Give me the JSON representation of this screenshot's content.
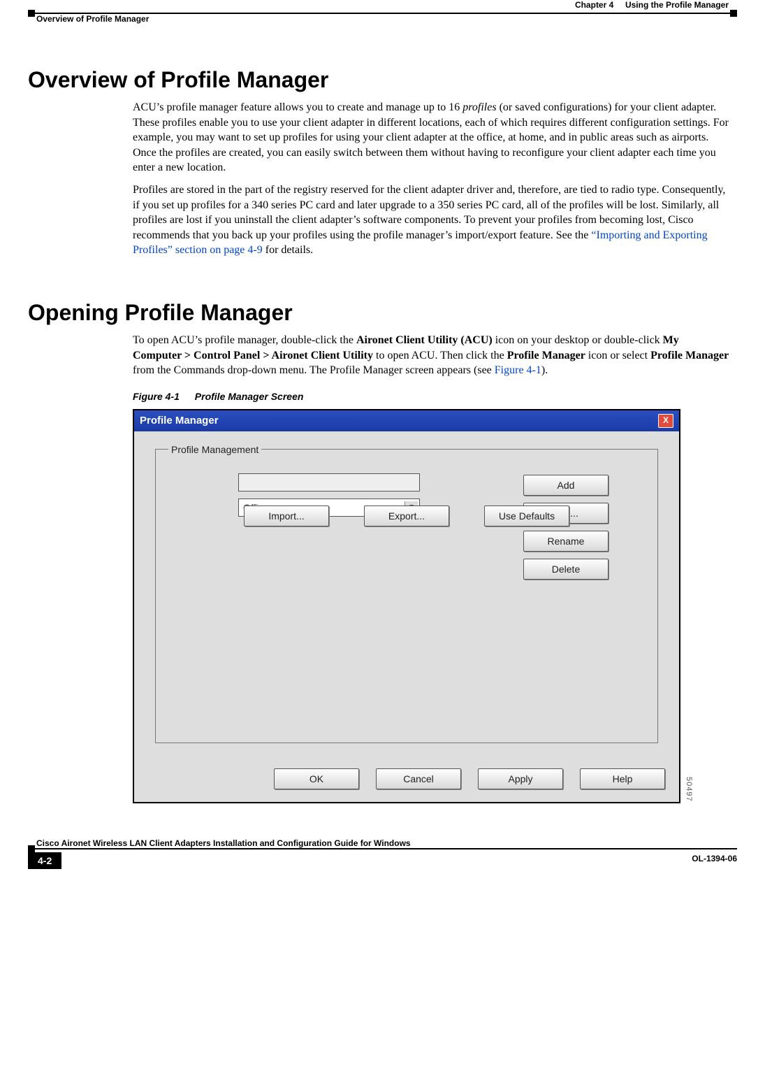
{
  "header": {
    "chapter_label": "Chapter 4",
    "chapter_title": "Using the Profile Manager",
    "section_title": "Overview of Profile Manager"
  },
  "section1": {
    "heading": "Overview of Profile Manager",
    "para1_a": "ACU’s profile manager feature allows you to create and manage up to 16 ",
    "para1_em": "profiles",
    "para1_b": " (or saved configurations) for your client adapter. These profiles enable you to use your client adapter in different locations, each of which requires different configuration settings. For example, you may want to set up profiles for using your client adapter at the office, at home, and in public areas such as airports. Once the profiles are created, you can easily switch between them without having to reconfigure your client adapter each time you enter a new location.",
    "para2_a": "Profiles are stored in the part of the registry reserved for the client adapter driver and, therefore, are tied to radio type. Consequently, if you set up profiles for a 340 series PC card and later upgrade to a 350 series PC card, all of the profiles will be lost. Similarly, all profiles are lost if you uninstall the client adapter’s software components. To prevent your profiles from becoming lost, Cisco recommends that you back up your profiles using the profile manager’s import/export feature. See the ",
    "para2_link": "“Importing and Exporting Profiles” section on page 4-9",
    "para2_b": " for details."
  },
  "section2": {
    "heading": "Opening Profile Manager",
    "para_a": "To open ACU’s profile manager, double-click the ",
    "para_b1": "Aironet Client Utility (ACU)",
    "para_c": " icon on your desktop or double-click ",
    "para_b2": "My Computer",
    "gt1": " > ",
    "para_b3": "Control Panel",
    "gt2": " > ",
    "para_b4": "Aironet Client Utility",
    "para_d": " to open ACU. Then click the ",
    "para_b5": "Profile Manager",
    "para_e": " icon or select ",
    "para_b6": "Profile Manager",
    "para_f": " from the Commands drop-down menu. The Profile Manager screen appears (see ",
    "para_link": "Figure 4-1",
    "para_g": ")."
  },
  "figure": {
    "num": "Figure 4-1",
    "title": "Profile Manager Screen",
    "side_id": "50497"
  },
  "dialog": {
    "title": "Profile Manager",
    "close": "X",
    "group_label": "Profile Management",
    "text_value": "",
    "combo_value": "Office",
    "buttons": {
      "add": "Add",
      "edit": "Edit...",
      "rename": "Rename",
      "delete": "Delete",
      "import": "Import...",
      "export": "Export...",
      "use_defaults": "Use Defaults",
      "ok": "OK",
      "cancel": "Cancel",
      "apply": "Apply",
      "help": "Help"
    }
  },
  "footer": {
    "guide": "Cisco Aironet Wireless LAN Client Adapters Installation and Configuration Guide for Windows",
    "page": "4-2",
    "doc": "OL-1394-06"
  }
}
